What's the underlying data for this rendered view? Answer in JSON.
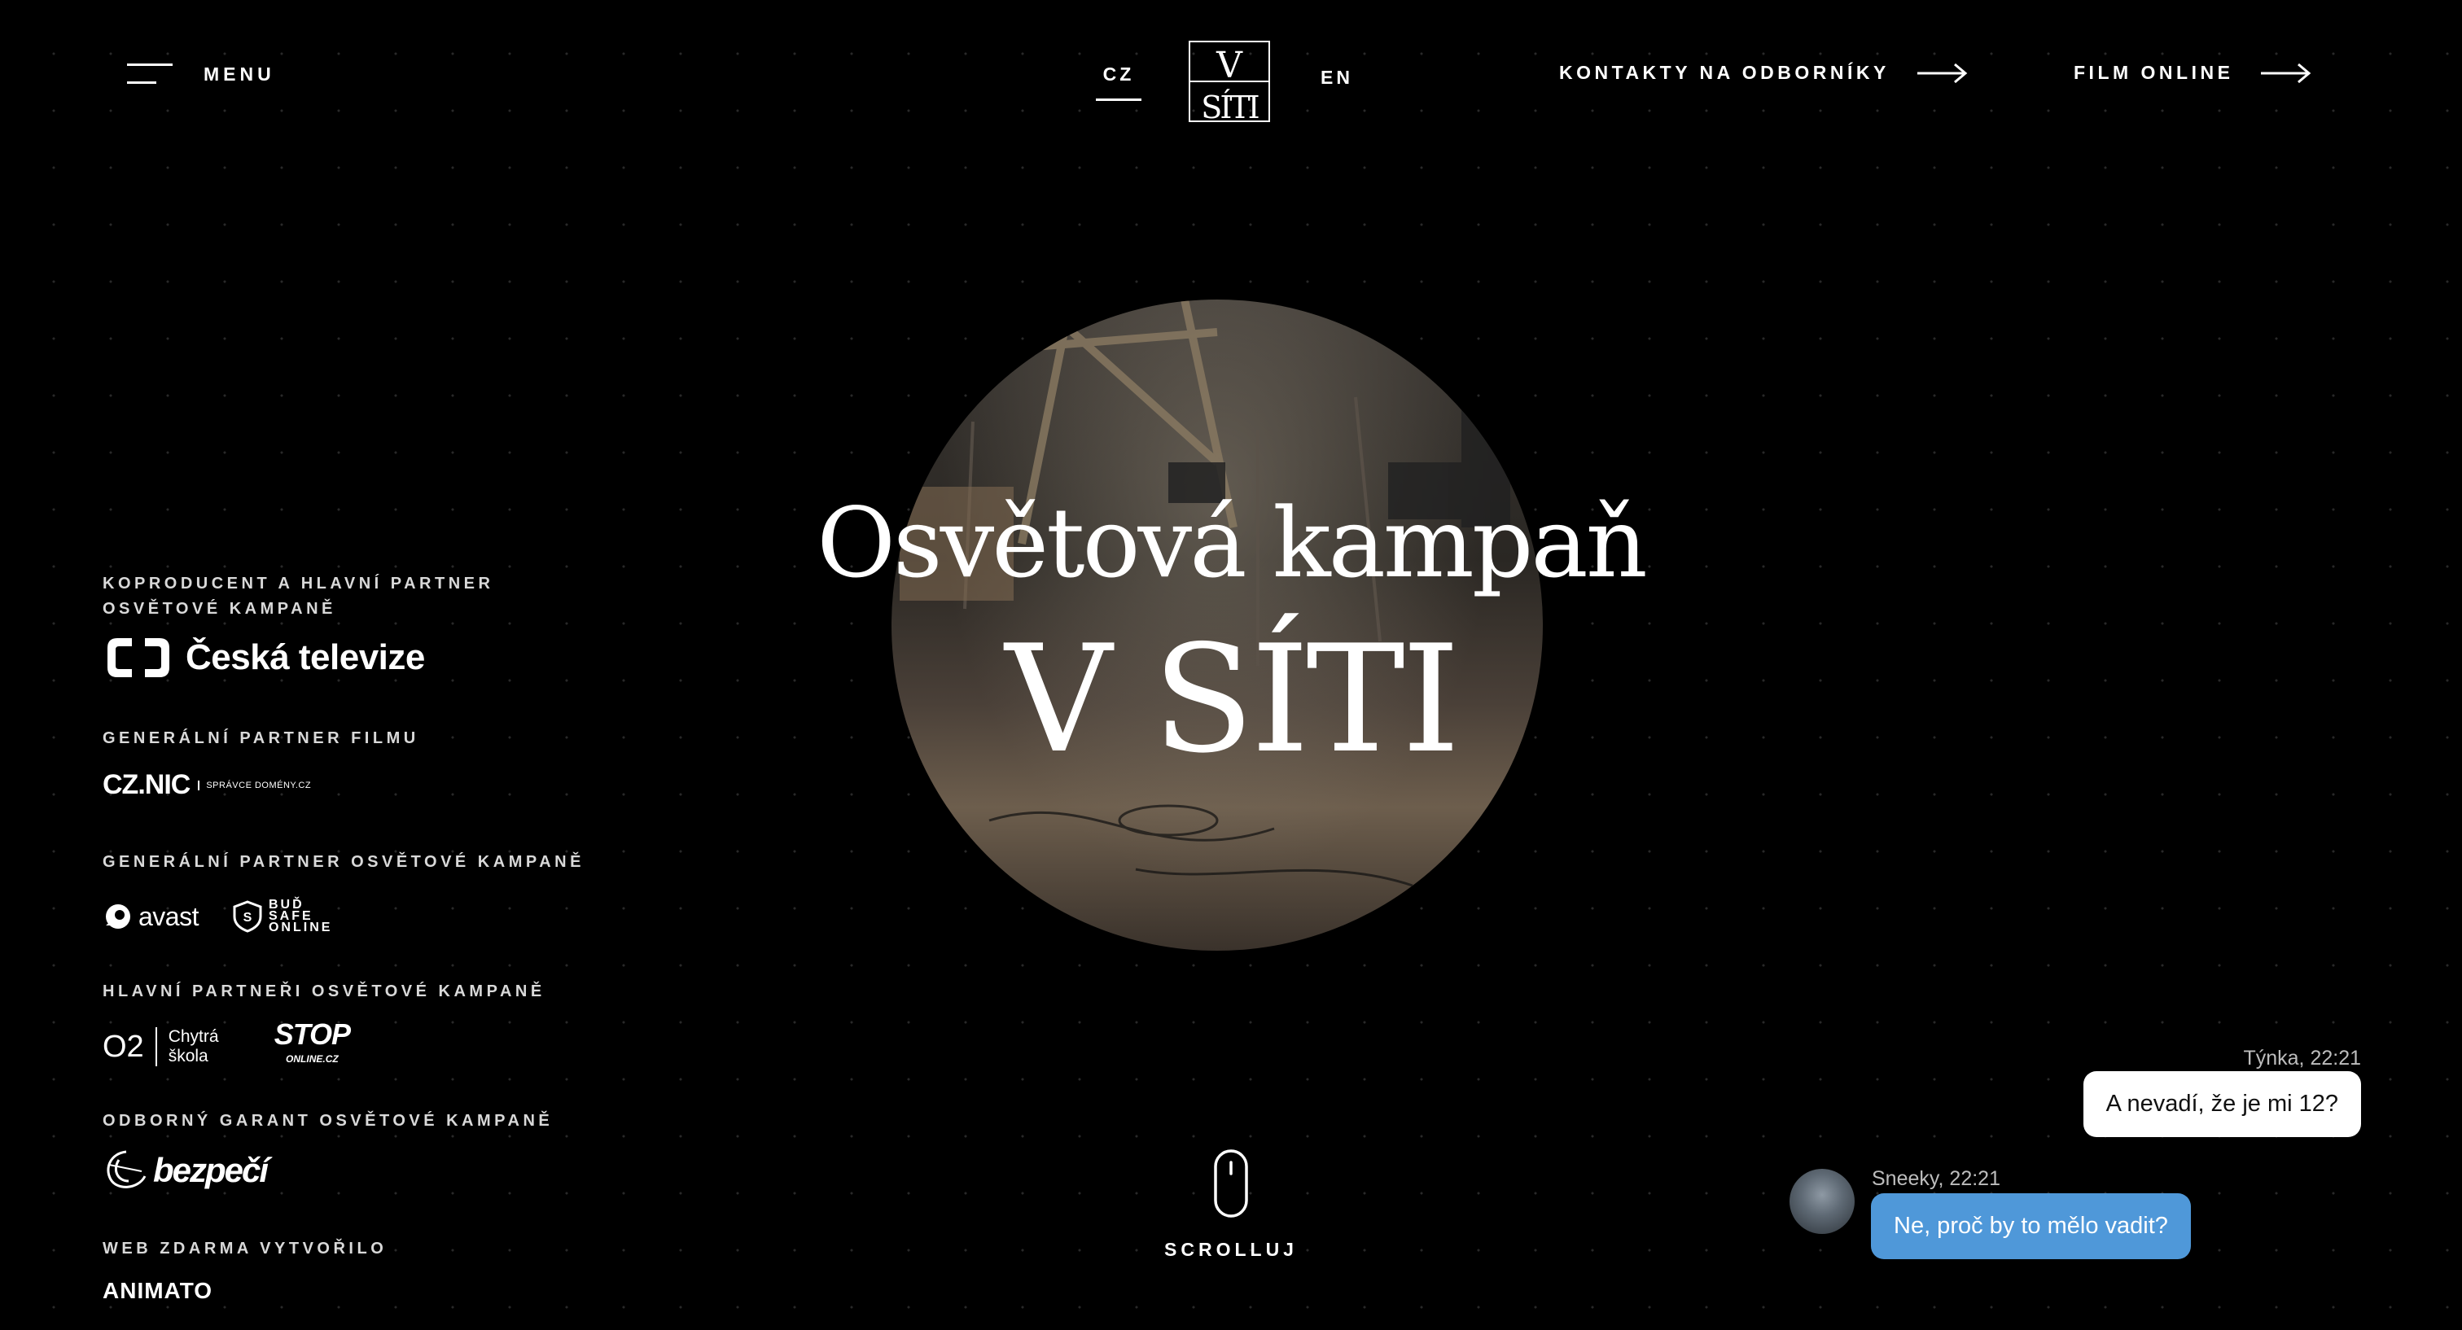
{
  "header": {
    "menu_label": "MENU",
    "lang_cz": "CZ",
    "lang_en": "EN",
    "logo_text": "V SÍTI",
    "contacts_label": "KONTAKTY NA ODBORNÍKY",
    "film_label": "FILM ONLINE"
  },
  "hero": {
    "title_line1": "Osvětová kampaň",
    "title_line2": "V SÍTI"
  },
  "partners": {
    "groups": [
      {
        "label": "KOPRODUCENT A HLAVNÍ PARTNER\nOSVĚTOVÉ KAMPANĚ",
        "logos": [
          "Česká televize"
        ]
      },
      {
        "label": "GENERÁLNÍ PARTNER FILMU",
        "logos": [
          "CZ.NIC",
          "SPRÁVCE DOMÉNY.CZ"
        ]
      },
      {
        "label": "GENERÁLNÍ PARTNER OSVĚTOVÉ KAMPANĚ",
        "logos": [
          "avast",
          "BUĎ SAFE ONLINE"
        ]
      },
      {
        "label": "HLAVNÍ PARTNEŘI OSVĚTOVÉ KAMPANĚ",
        "logos": [
          "O2",
          "Chytrá škola",
          "STOP",
          "ONLINE.CZ"
        ]
      },
      {
        "label": "ODBORNÝ GARANT OSVĚTOVÉ KAMPANĚ",
        "logos": [
          "bezpečí"
        ]
      },
      {
        "label": "WEB ZDARMA VYTVOŘILO",
        "logos": [
          "ANIMATO"
        ]
      }
    ]
  },
  "scroll": {
    "label": "SCROLLUJ"
  },
  "chat": {
    "messages": [
      {
        "meta": "Týnka, 22:21",
        "text": "A nevadí, že je mi 12?"
      },
      {
        "meta": "Sneeky, 22:21",
        "text": "Ne, proč by to mělo vadit?"
      }
    ]
  },
  "colors": {
    "background": "#000000",
    "text": "#ffffff",
    "chat_blue": "#4f98d9",
    "chat_white": "#ffffff"
  },
  "icons": [
    "hamburger-icon",
    "arrow-right-icon",
    "mouse-scroll-icon",
    "avatar"
  ]
}
